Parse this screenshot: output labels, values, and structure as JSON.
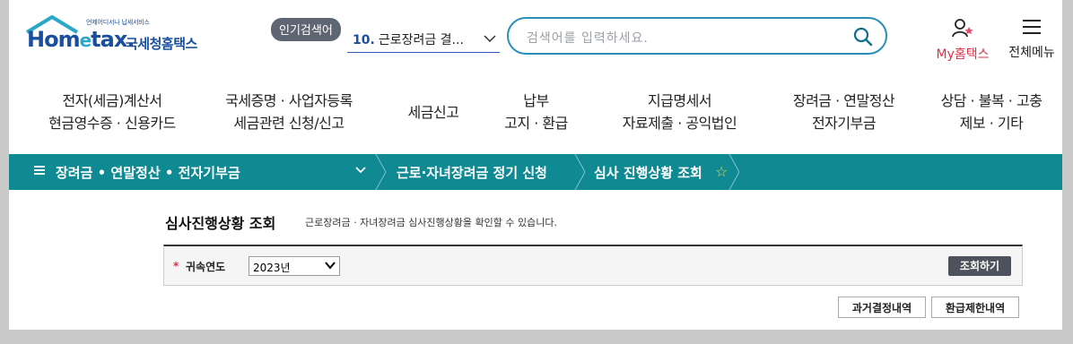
{
  "header": {
    "logo_tagline": "언제어디서나 납세서비스",
    "logo_brand_ho": "Hom",
    "logo_brand_e": "e",
    "logo_brand_tax": "tax.",
    "logo_name": "국세청홈택스",
    "hot_keyword_badge": "인기검색어",
    "hot_keyword_number": "10.",
    "hot_keyword_text": "근로장려금 결...",
    "search_placeholder": "검색어를 입력하세요.",
    "my_label": "My홈택스",
    "all_menu_label": "전체메뉴"
  },
  "main_nav": [
    {
      "line1": "전자(세금)계산서",
      "line2": "현금영수증 · 신용카드"
    },
    {
      "line1": "국세증명 · 사업자등록",
      "line2": "세금관련 신청/신고"
    },
    {
      "line1": "세금신고",
      "line2": ""
    },
    {
      "line1": "납부",
      "line2": "고지 · 환급"
    },
    {
      "line1": "지급명세서",
      "line2": "자료제출 · 공익법인"
    },
    {
      "line1": "장려금 · 연말정산",
      "line2": "전자기부금"
    },
    {
      "line1": "상담 · 불복 · 고충",
      "line2": "제보 · 기타"
    }
  ],
  "breadcrumb": {
    "section": "장려금 • 연말정산 • 전자기부금",
    "sub": "근로·자녀장려금 정기 신청",
    "current": "심사 진행상황 조회"
  },
  "page": {
    "title": "심사진행상황 조회",
    "description": "근로장려금 · 자녀장려금 심사진행상황을 확인할 수 있습니다."
  },
  "form": {
    "required_mark": "*",
    "year_label": "귀속연도",
    "year_value": "2023년",
    "query_button": "조회하기"
  },
  "actions": {
    "past_decisions": "과거결정내역",
    "refund_limit": "환급제한내역"
  },
  "colors": {
    "teal_bar": "#0f8a92",
    "brand_blue": "#1a4fa0",
    "my_red": "#d8334a"
  }
}
